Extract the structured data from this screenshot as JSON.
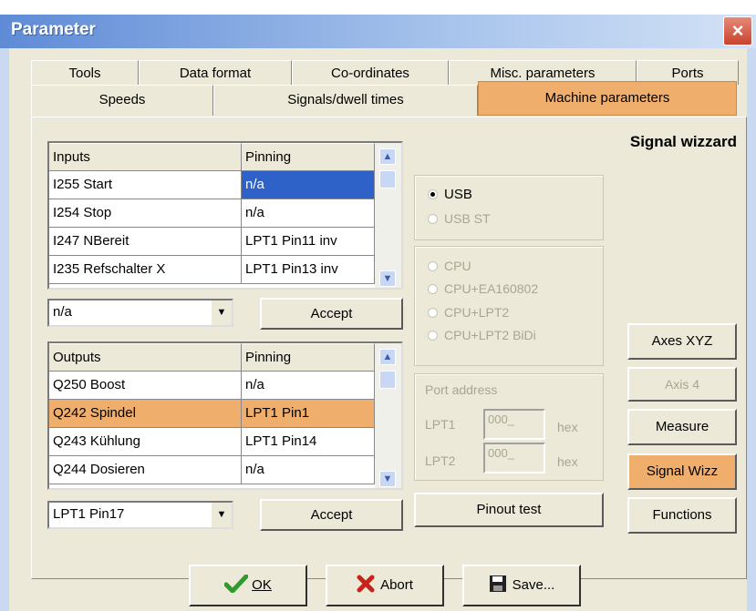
{
  "window": {
    "title": "Parameter",
    "close_glyph": "×"
  },
  "tabs_row1": [
    "Tools",
    "Data format",
    "Co-ordinates",
    "Misc. parameters",
    "Ports"
  ],
  "tabs_row2": [
    "Speeds",
    "Signals/dwell times",
    "Machine parameters"
  ],
  "active_tab": "Machine parameters",
  "section_title": "Signal wizzard",
  "inputs_table": {
    "headers": [
      "Inputs",
      "Pinning"
    ],
    "rows": [
      [
        "I255 Start",
        "n/a"
      ],
      [
        "I254 Stop",
        "n/a"
      ],
      [
        "I247 NBereit",
        "LPT1 Pin11 inv"
      ],
      [
        "I235 Refschalter X",
        "LPT1 Pin13 inv"
      ]
    ],
    "selected_row": 0
  },
  "inputs_combo": {
    "value": "n/a"
  },
  "inputs_accept": "Accept",
  "outputs_table": {
    "headers": [
      "Outputs",
      "Pinning"
    ],
    "rows": [
      [
        "Q250 Boost",
        "n/a"
      ],
      [
        "Q242 Spindel",
        "LPT1 Pin1"
      ],
      [
        "Q243 Kühlung",
        "LPT1 Pin14"
      ],
      [
        "Q244 Dosieren",
        "n/a"
      ]
    ],
    "selected_row": 1
  },
  "outputs_combo": {
    "value": "LPT1 Pin17"
  },
  "outputs_accept": "Accept",
  "interface_group": {
    "options": [
      "USB",
      "USB ST"
    ],
    "selected": "USB"
  },
  "cpu_group": {
    "options": [
      "CPU",
      "CPU+EA160802",
      "CPU+LPT2",
      "CPU+LPT2 BiDi"
    ]
  },
  "port_group": {
    "label": "Port address",
    "lpt1": {
      "label": "LPT1",
      "value": "000_",
      "unit": "hex"
    },
    "lpt2": {
      "label": "LPT2",
      "value": "000_",
      "unit": "hex"
    }
  },
  "pinout_button": "Pinout test",
  "side_buttons": {
    "axes": "Axes XYZ",
    "axis4": "Axis 4",
    "measure": "Measure",
    "signal_wizz": "Signal Wizz",
    "functions": "Functions"
  },
  "bottom_buttons": {
    "ok": "OK",
    "abort": "Abort",
    "save": "Save..."
  },
  "colors": {
    "accent_orange": "#f0ae6c",
    "selection_blue": "#2f62c9",
    "ok_check": "#2e9b2e",
    "abort_x": "#c8231b"
  }
}
